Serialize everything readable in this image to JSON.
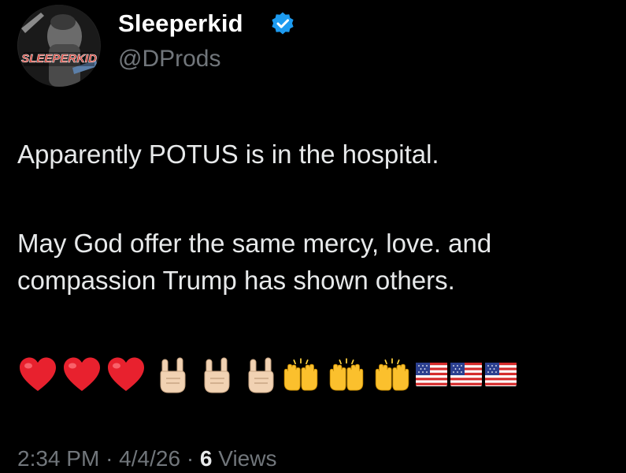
{
  "user": {
    "display_name": "Sleeperkid",
    "handle": "@DProds",
    "verified": true,
    "verified_color": "#1d9bf0",
    "avatar_text": "SLEEPERKID"
  },
  "tweet": {
    "line1": "Apparently POTUS is in the hospital.",
    "line2": "May God offer the same mercy, love. and",
    "line3": "compassion Trump has shown others.",
    "emojis": [
      "red-heart",
      "red-heart",
      "red-heart",
      "sign-of-horns",
      "sign-of-horns",
      "sign-of-horns",
      "raising-hands",
      "raising-hands",
      "raising-hands",
      "us-flag",
      "us-flag",
      "us-flag"
    ]
  },
  "meta": {
    "time": "2:34 PM",
    "separator": "·",
    "date": "4/4/26",
    "views_count": "6",
    "views_label": "Views"
  },
  "colors": {
    "background": "#000000",
    "text": "#e7e9ea",
    "secondary": "#71767b"
  }
}
